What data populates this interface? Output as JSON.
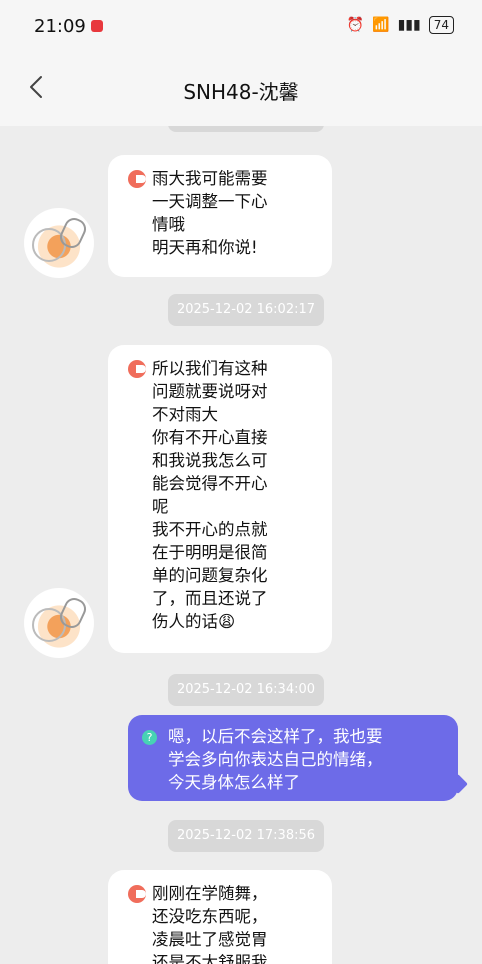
{
  "status": {
    "time": "21:09",
    "battery": "74"
  },
  "header": {
    "title": "SNH48-沈馨"
  },
  "messages": [
    {
      "side": "left",
      "text": "雨大我可能需要\n一天调整一下心\n情哦\n明天再和你说!"
    },
    {
      "type": "time",
      "text": "2025-12-02 16:02:17"
    },
    {
      "side": "left",
      "text": "所以我们有这种\n问题就要说呀对\n不对雨大\n你有不开心直接\n和我说我怎么可\n能会觉得不开心\n呢\n我不开心的点就\n在于明明是很简\n单的问题复杂化\n了，而且还说了\n伤人的话😩"
    },
    {
      "type": "time",
      "text": "2025-12-02 16:34:00"
    },
    {
      "side": "right",
      "text": "嗯，以后不会这样了，我也要\n学会多向你表达自己的情绪，\n今天身体怎么样了"
    },
    {
      "type": "time",
      "text": "2025-12-02 17:38:56"
    },
    {
      "side": "left",
      "text": "刚刚在学随舞，\n还没吃东西呢，\n凌晨吐了感觉胃\n还是不太舒服我"
    }
  ],
  "icons": {
    "back": "chevron-left-icon",
    "message": "message-icon",
    "help": "question-icon"
  }
}
